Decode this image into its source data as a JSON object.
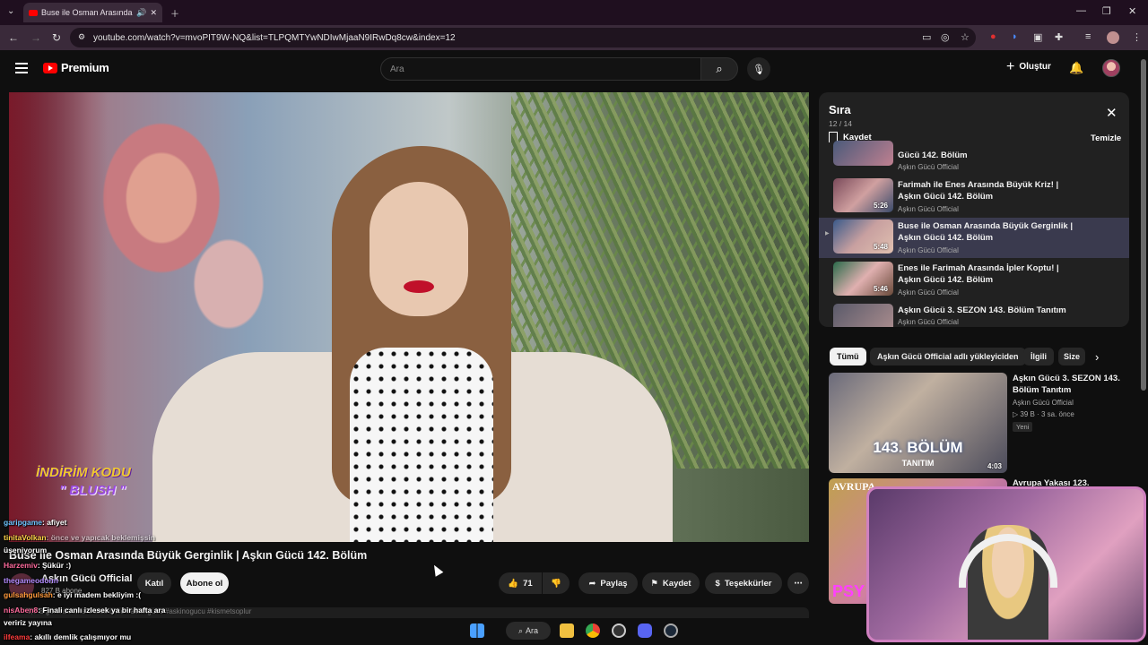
{
  "browser": {
    "tab_title": "Buse ile Osman Arasında Bü",
    "url": "youtube.com/watch?v=mvoPIT9W-NQ&list=TLPQMTYwNDIwMjaaN9IRwDq8cw&index=12"
  },
  "youtube": {
    "logo_text": "Premium",
    "search_placeholder": "Ara",
    "create_label": "Oluştur"
  },
  "video": {
    "promo_line1": "İNDİRİM KODU",
    "promo_line2": "\" BLUSH \"",
    "title": "Buse ile Osman Arasında Büyük Gerginlik | Aşkın Gücü 142. Bölüm",
    "channel": "Aşkın Gücü Official",
    "subscribers": "827 B abone",
    "join_label": "Katıl",
    "subscribe_label": "Abone ol",
    "likes": "71",
    "share_label": "Paylaş",
    "save_label": "Kaydet",
    "thanks_label": "Teşekkürler",
    "description_snippet": "1,8 B görüntüleme  3 saat önce  #askingucu #askinogucu #kismetsoplur"
  },
  "chat": [
    {
      "user": "garipgame",
      "text": ": afiyet",
      "color": "#6ec6ff"
    },
    {
      "user": "tinitaVolkan",
      "text": ": önce ve yapıcak beklemişsin",
      "color": "#ffd54a"
    },
    {
      "user": "",
      "text": "üşeniyorum",
      "color": "#fff"
    },
    {
      "user": "Harzemiv",
      "text": ": Şükür :)",
      "color": "#ff6b9d"
    },
    {
      "user": "thegameodonn",
      "text": "",
      "color": "#b48cff"
    },
    {
      "user": "gulsahgulsah",
      "text": ": e iyi madem bekliyim :(",
      "color": "#ff9a3c"
    },
    {
      "user": "nisAben8",
      "text": ": Finali canlı izlesek ya bir hafta ara",
      "color": "#ff6b9d"
    },
    {
      "user": "",
      "text": "veririz yayına",
      "color": "#fff"
    },
    {
      "user": "ilfeama",
      "text": ": akıllı demlik çalışmıyor mu",
      "color": "#ff3c3c"
    }
  ],
  "playlist": {
    "title": "Sıra",
    "position": "12 / 14",
    "save_label": "Kaydet",
    "clear_label": "Temizle",
    "items": [
      {
        "title": "Gücü 142. Bölüm",
        "channel": "Aşkın Gücü Official",
        "duration": ""
      },
      {
        "title": "Farimah ile Enes Arasında Büyük Kriz! | Aşkın Gücü 142. Bölüm",
        "channel": "Aşkın Gücü Official",
        "duration": "5:26"
      },
      {
        "title": "Buse ile Osman Arasında Büyük Gerginlik | Aşkın Gücü 142. Bölüm",
        "channel": "Aşkın Gücü Official",
        "duration": "5:48"
      },
      {
        "title": "Enes ile Farimah Arasında İpler Koptu! | Aşkın Gücü 142. Bölüm",
        "channel": "Aşkın Gücü Official",
        "duration": "5:46"
      },
      {
        "title": "Aşkın Gücü 3. SEZON 143. Bölüm Tanıtım",
        "channel": "Aşkın Gücü Official",
        "duration": ""
      }
    ]
  },
  "chips": [
    "Tümü",
    "Aşkın Gücü Official adlı yükleyiciden",
    "İlgili",
    "Size"
  ],
  "recommendations": [
    {
      "title": "Aşkın Gücü 3. SEZON 143. Bölüm Tanıtım",
      "channel": "Aşkın Gücü Official",
      "meta": "39 B · 3 sa. önce",
      "badge": "Yeni",
      "duration": "4:03",
      "overlay1": "143. BÖLÜM",
      "overlay2": "TANITIM"
    },
    {
      "title": "Avrupa Yakası 123.",
      "overlay1": "AVRUPA",
      "overlay2": "PSY"
    }
  ],
  "taskbar": {
    "search_label": "Ara"
  },
  "colors": {
    "background": "#0f0f0f",
    "accent_red": "#ff0000",
    "panel": "#212121",
    "chip": "#272727",
    "webcam_border": "#d080c0"
  }
}
